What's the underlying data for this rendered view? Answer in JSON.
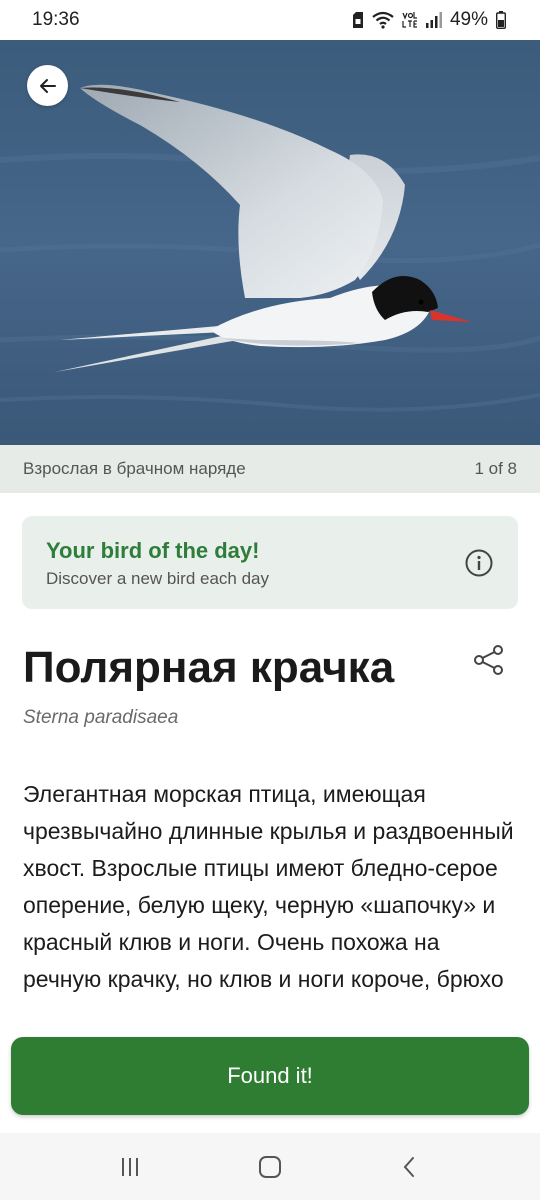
{
  "status_bar": {
    "time": "19:36",
    "battery": "49%",
    "icons": [
      "sim-card-icon",
      "wifi-icon",
      "volte-icon",
      "signal-icon",
      "battery-icon"
    ]
  },
  "hero": {
    "image_alt": "arctic-tern-in-flight-photo",
    "back_icon": "arrow-left-icon"
  },
  "caption": {
    "text": "Взрослая в брачном наряде",
    "counter": "1 of 8"
  },
  "bird_of_day": {
    "title": "Your bird of the day!",
    "subtitle": "Discover a new bird each day",
    "icon": "info-icon"
  },
  "bird": {
    "name": "Полярная крачка",
    "latin": "Sterna paradisaea",
    "description": "Элегантная морская птица, имеющая чрезвычайно длинные крылья и раздвоенный хвост. Взрослые птицы имеют бледно-серое оперение, белую щеку, черную «шапочку» и красный клюв и ноги. Очень похожа на речную крачку, но клюв и ноги короче, брюхо"
  },
  "actions": {
    "share_icon": "share-icon",
    "found_label": "Found it!"
  },
  "nav": {
    "icons": [
      "recent-apps-icon",
      "home-icon",
      "back-icon"
    ]
  },
  "colors": {
    "accent_green": "#2e7d32",
    "title_green": "#2f7d3b",
    "card_bg": "#e9efeb"
  }
}
